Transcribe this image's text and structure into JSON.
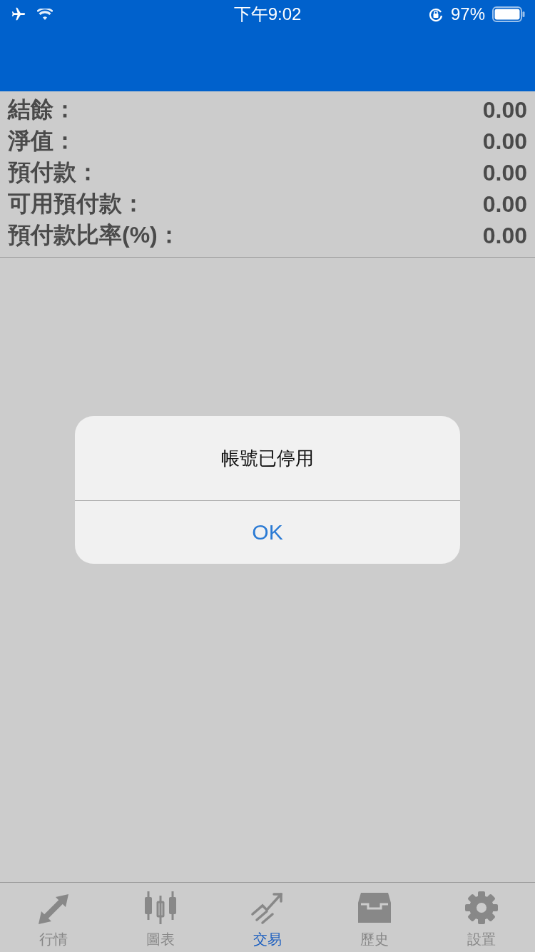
{
  "status_bar": {
    "time": "下午9:02",
    "battery": "97%"
  },
  "account": [
    {
      "label": "結餘：",
      "value": "0.00"
    },
    {
      "label": "淨值：",
      "value": "0.00"
    },
    {
      "label": "預付款：",
      "value": "0.00"
    },
    {
      "label": "可用預付款：",
      "value": "0.00"
    },
    {
      "label": "預付款比率(%)：",
      "value": "0.00"
    }
  ],
  "alert": {
    "message": "帳號已停用",
    "button": "OK"
  },
  "tab_bar": [
    {
      "label": "行情",
      "kind": "quotes",
      "selected": false
    },
    {
      "label": "圖表",
      "kind": "chart",
      "selected": false
    },
    {
      "label": "交易",
      "kind": "trade",
      "selected": true
    },
    {
      "label": "歷史",
      "kind": "history",
      "selected": false
    },
    {
      "label": "設置",
      "kind": "settings",
      "selected": false
    }
  ]
}
